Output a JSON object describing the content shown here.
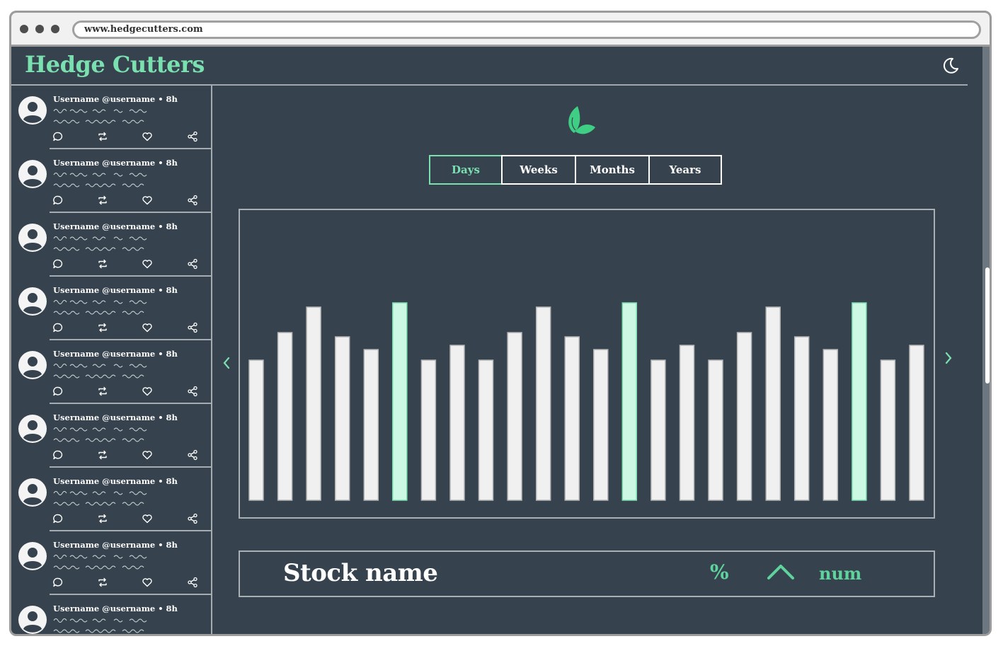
{
  "browser": {
    "url": "www.hedgecutters.com"
  },
  "header": {
    "brand": "Hedge Cutters",
    "theme_icon": "moon-icon"
  },
  "feed": {
    "posts": [
      {
        "user": "Username @username • 8h"
      },
      {
        "user": "Username @username • 8h"
      },
      {
        "user": "Username @username • 8h"
      },
      {
        "user": "Username @username • 8h"
      },
      {
        "user": "Username @username • 8h"
      },
      {
        "user": "Username @username • 8h"
      },
      {
        "user": "Username @username • 8h"
      },
      {
        "user": "Username @username • 8h"
      },
      {
        "user": "Username @username • 8h"
      }
    ],
    "action_icons": [
      "comment-icon",
      "retweet-icon",
      "heart-icon",
      "share-icon"
    ]
  },
  "tabs": [
    {
      "label": "Days",
      "active": true
    },
    {
      "label": "Weeks",
      "active": false
    },
    {
      "label": "Months",
      "active": false
    },
    {
      "label": "Years",
      "active": false
    }
  ],
  "chart_data": {
    "type": "bar",
    "values": [
      66,
      79,
      91,
      77,
      71,
      93,
      66,
      73,
      66,
      79,
      91,
      77,
      71,
      93,
      66,
      73,
      66,
      79,
      91,
      77,
      71,
      93,
      66,
      73
    ],
    "highlighted": [
      5,
      13,
      21
    ],
    "ylim": [
      0,
      100
    ],
    "grid": false,
    "colors": {
      "bar": "#f0f0f0",
      "highlight": "#cdf8e4",
      "highlight_stroke": "#7be0b0"
    }
  },
  "stock": {
    "name": "Stock name",
    "percent": "%",
    "trend_icon": "chevron-up-icon",
    "value": "num"
  },
  "colors": {
    "background": "#36434e",
    "accent": "#7be0b0",
    "accent_dark": "#5fd39c"
  }
}
